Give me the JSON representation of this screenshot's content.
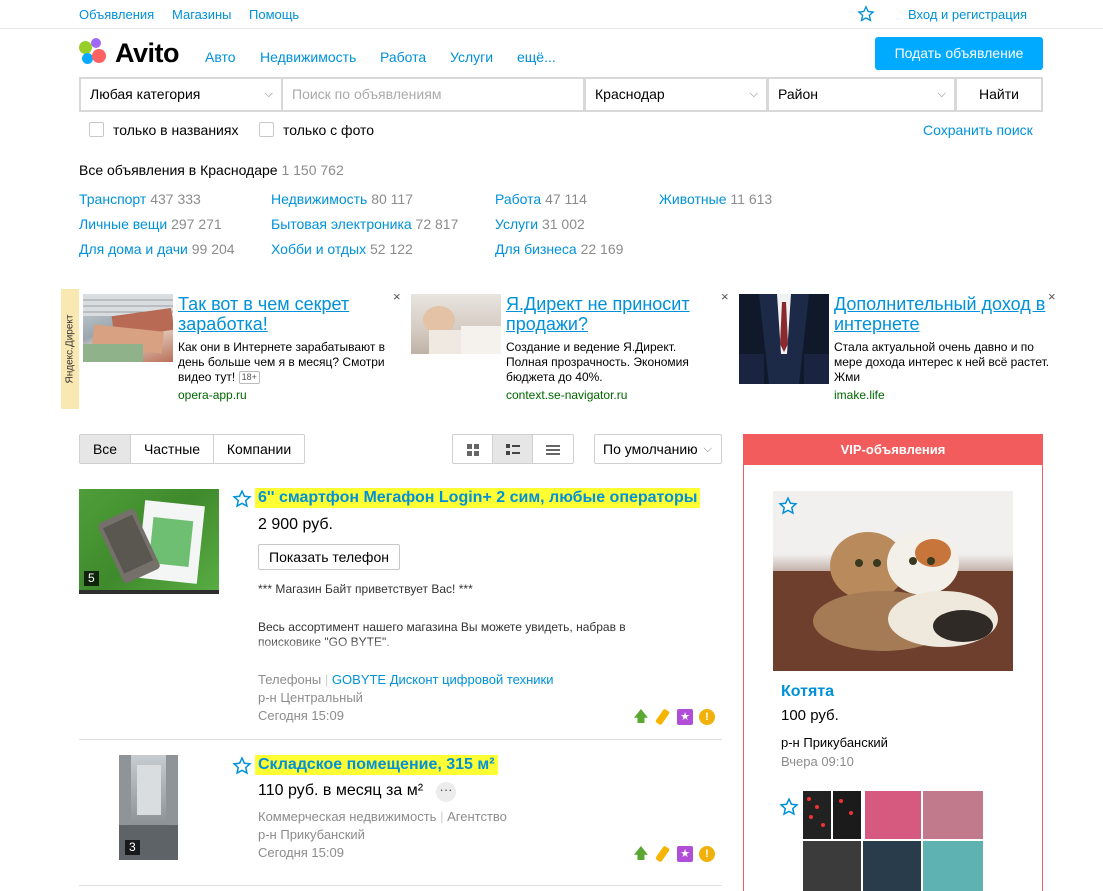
{
  "topbar": {
    "links": [
      "Объявления",
      "Магазины",
      "Помощь"
    ],
    "login": "Вход и регистрация",
    "favorites_icon": "star-icon"
  },
  "header": {
    "logo_text": "Avito",
    "nav": [
      "Авто",
      "Недвижимость",
      "Работа",
      "Услуги",
      "ещё..."
    ],
    "post_button": "Подать объявление"
  },
  "search": {
    "category": "Любая категория",
    "query_placeholder": "Поиск по объявлениям",
    "city": "Краснодар",
    "district": "Район",
    "find_button": "Найти",
    "only_titles": "только в названиях",
    "only_photo": "только с фото",
    "save_search": "Сохранить поиск"
  },
  "categories": {
    "heading": "Все объявления в Краснодаре",
    "heading_count": "1 150 762",
    "items": [
      {
        "label": "Транспорт",
        "count": "437 333"
      },
      {
        "label": "Недвижимость",
        "count": "80 117"
      },
      {
        "label": "Работа",
        "count": "47 114"
      },
      {
        "label": "Животные",
        "count": "11 613"
      },
      {
        "label": "Личные вещи",
        "count": "297 271"
      },
      {
        "label": "Бытовая электроника",
        "count": "72 817"
      },
      {
        "label": "Услуги",
        "count": "31 002"
      },
      {
        "label": "Для дома и дачи",
        "count": "99 204"
      },
      {
        "label": "Хобби и отдых",
        "count": "52 122"
      },
      {
        "label": "Для бизнеса",
        "count": "22 169"
      }
    ]
  },
  "ads": {
    "label": "Яндекс.Директ",
    "items": [
      {
        "title": "Так вот в чем секрет заработка!",
        "text": "Как они в Интернете зарабатывают в день больше чем я в месяц? Смотри видео тут!",
        "age": "18+",
        "domain": "opera-app.ru"
      },
      {
        "title": "Я.Директ не приносит продажи?",
        "text": "Создание и ведение Я.Директ. Полная прозрачность. Экономия бюджета до 40%.",
        "domain": "context.se-navigator.ru"
      },
      {
        "title": "Дополнительный доход в интернете",
        "text": "Стала актуальной очень давно и по мере дохода интерес к ней всё растет. Жми",
        "domain": "imake.life"
      }
    ],
    "close": "×"
  },
  "filters": {
    "seller_tabs": [
      "Все",
      "Частные",
      "Компании"
    ],
    "active_tab": "Все",
    "view_modes": [
      "grid-view-icon",
      "list-view-icon",
      "compact-view-icon"
    ],
    "sort": "По умолчанию"
  },
  "listings": [
    {
      "title": "6'' смартфон Мегафон Login+ 2 сим, любые операторы",
      "price": "2 900 руб.",
      "photos": "5",
      "phone_button": "Показать телефон",
      "desc1": "*** Магазин Байт приветствует Вас! ***",
      "desc2": "Весь ассортимент нашего магазина Вы можете увидеть, набрав в поисковике \"GO BYTE\".",
      "category": "Телефоны",
      "seller": "GOBYTE Дисконт цифровой техники",
      "district": "р-н Центральный",
      "date": "Сегодня 15:09"
    },
    {
      "title": "Складское помещение, 315 м²",
      "price": "110 руб. в месяц за м²",
      "photos": "3",
      "more": "···",
      "category": "Коммерческая недвижимость",
      "seller": "Агентство",
      "district": "р-н Прикубанский",
      "date": "Сегодня 15:09"
    }
  ],
  "vip": {
    "heading": "VIP-объявления",
    "items": [
      {
        "title": "Котята",
        "price": "100 руб.",
        "district": "р-н Прикубанский",
        "date": "Вчера 09:10"
      }
    ]
  }
}
